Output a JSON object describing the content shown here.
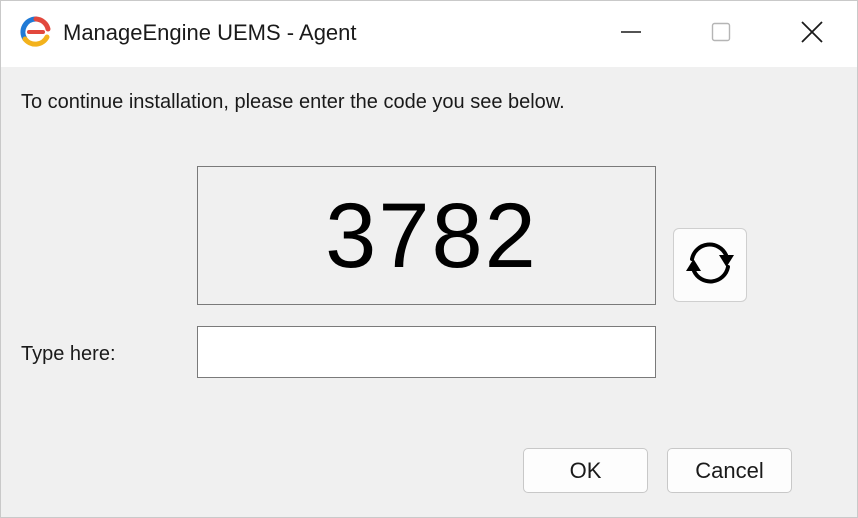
{
  "window": {
    "title": "ManageEngine UEMS - Agent"
  },
  "titlebar": {
    "app_icon": "manageengine-logo-icon",
    "minimize_icon": "minimize-icon",
    "maximize_icon": "maximize-icon",
    "close_icon": "close-icon"
  },
  "dialog": {
    "instruction": "To continue installation, please enter the code you see below.",
    "code": "3782",
    "refresh_icon": "refresh-icon",
    "input_label": "Type here:",
    "input_value": "",
    "input_placeholder": "",
    "ok_label": "OK",
    "cancel_label": "Cancel"
  },
  "colors": {
    "logo_blue": "#1f7ad6",
    "logo_red": "#e2483d",
    "logo_yellow": "#f3b21c",
    "background": "#f0f0f0"
  }
}
